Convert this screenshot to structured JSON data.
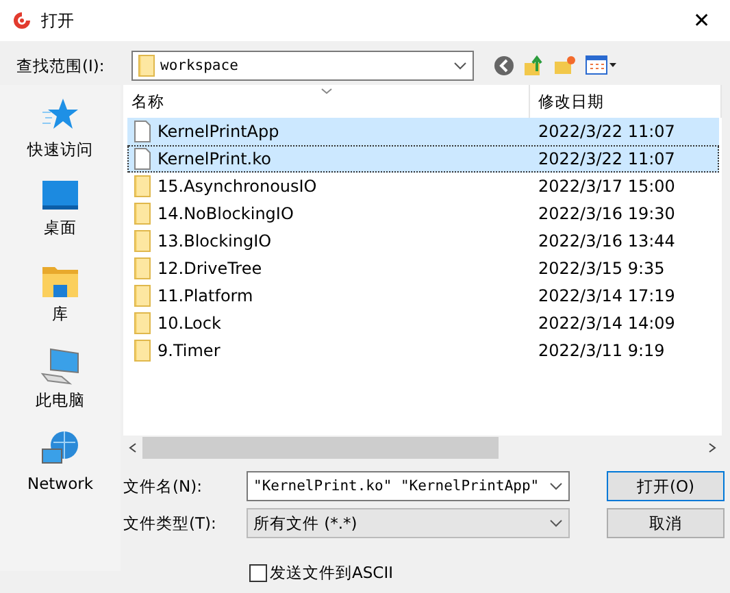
{
  "window": {
    "title": "打开",
    "close": "✕"
  },
  "look_in": {
    "label": "查找范围(I):",
    "value": "workspace"
  },
  "sidebar": {
    "items": [
      {
        "label": "快速访问"
      },
      {
        "label": "桌面"
      },
      {
        "label": "库"
      },
      {
        "label": "此电脑"
      },
      {
        "label": "Network"
      }
    ]
  },
  "table": {
    "columns": [
      "名称",
      "修改日期"
    ],
    "rows": [
      {
        "kind": "file",
        "name": "KernelPrintApp",
        "date": "2022/3/22 11:07",
        "selected": true
      },
      {
        "kind": "file",
        "name": "KernelPrint.ko",
        "date": "2022/3/22 11:07",
        "selected": true
      },
      {
        "kind": "folder",
        "name": "15.AsynchronousIO",
        "date": "2022/3/17 15:00",
        "selected": false
      },
      {
        "kind": "folder",
        "name": "14.NoBlockingIO",
        "date": "2022/3/16 19:30",
        "selected": false
      },
      {
        "kind": "folder",
        "name": "13.BlockingIO",
        "date": "2022/3/16 13:44",
        "selected": false
      },
      {
        "kind": "folder",
        "name": "12.DriveTree",
        "date": "2022/3/15 9:35",
        "selected": false
      },
      {
        "kind": "folder",
        "name": "11.Platform",
        "date": "2022/3/14 17:19",
        "selected": false
      },
      {
        "kind": "folder",
        "name": "10.Lock",
        "date": "2022/3/14 14:09",
        "selected": false
      },
      {
        "kind": "folder",
        "name": "9.Timer",
        "date": "2022/3/11 9:19",
        "selected": false
      }
    ]
  },
  "file_name": {
    "label": "文件名(N):",
    "value": "\"KernelPrint.ko\" \"KernelPrintApp\""
  },
  "file_type": {
    "label": "文件类型(T):",
    "value": "所有文件 (*.*)"
  },
  "buttons": [
    "打开(O)",
    "取消"
  ],
  "send_ascii": {
    "label": "发送文件到ASCII",
    "checked": false
  }
}
